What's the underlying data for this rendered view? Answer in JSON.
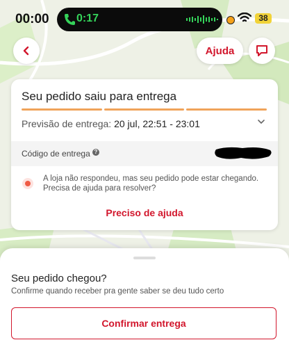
{
  "status_bar": {
    "time": "00:00",
    "call_duration": "0:17",
    "battery_level": "38"
  },
  "header": {
    "help_label": "Ajuda"
  },
  "order_card": {
    "title": "Seu pedido saiu para entrega",
    "progress_segments": 3,
    "forecast_label": "Previsão de entrega:",
    "forecast_value": "20 jul, 22:51 - 23:01",
    "delivery_code_label": "Código de entrega",
    "alert_text": "A loja não respondeu, mas seu pedido pode estar chegando. Precisa de ajuda para resolver?",
    "help_link": "Preciso de ajuda"
  },
  "bottom_sheet": {
    "title": "Seu pedido chegou?",
    "subtitle": "Confirme quando receber pra gente saber se deu tudo certo",
    "confirm_button": "Confirmar entrega"
  },
  "colors": {
    "accent": "#d2162c",
    "progress": "#f0a35a",
    "call_green": "#35d35a"
  },
  "icons": {
    "back": "chevron-left-icon",
    "chat": "chat-bubble-icon",
    "phone": "phone-icon",
    "wifi": "wifi-icon",
    "info": "info-icon",
    "expand": "chevron-down-icon"
  }
}
